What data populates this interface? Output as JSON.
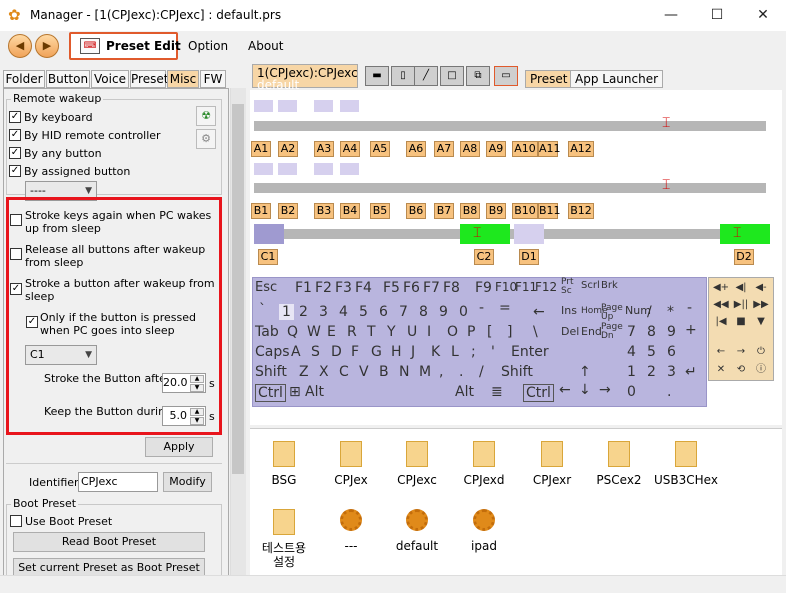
{
  "window": {
    "title": "Manager - [1(CPJexc):CPJexc] : default.prs",
    "controls": [
      "—",
      "☐",
      "✕"
    ]
  },
  "menubar": {
    "back": "◀",
    "forward": "▶",
    "preset_edit": "Preset Edit",
    "option": "Option",
    "about": "About"
  },
  "left_tabs": [
    "Folder",
    "Button",
    "Voice",
    "Preset",
    "Misc",
    "FW"
  ],
  "active_left_tab": "Misc",
  "remote_wakeup": {
    "title": "Remote wakeup",
    "by_keyboard": "By keyboard",
    "by_hid": "By HID remote controller",
    "by_any_button": "By any button",
    "by_assigned_button": "By assigned button",
    "assigned_value": "----",
    "checked": [
      true,
      true,
      true,
      true
    ]
  },
  "wake_options": {
    "stroke_keys_again": "Stroke keys again when PC wakes up from sleep",
    "release_all": "Release all buttons after wakeup from sleep",
    "stroke_button": "Stroke a button after wakeup from sleep",
    "only_if_pressed": "Only if the button is pressed when PC goes into sleep",
    "button_value": "C1",
    "stroke_after_label": "Stroke the Button after",
    "stroke_after_value": "20.0",
    "keep_during_label": "Keep the Button during",
    "keep_during_value": "5.0",
    "unit": "s",
    "apply": "Apply"
  },
  "identifier": {
    "label": "Identifier",
    "value": "CPJexc",
    "modify": "Modify"
  },
  "boot_preset": {
    "title": "Boot Preset",
    "use": "Use Boot Preset",
    "read": "Read Boot Preset",
    "set_current": "Set current Preset as Boot Preset"
  },
  "right_tabs": {
    "device_tab_line1": "1(CPJexc):CPJexc",
    "device_tab_line2": "default",
    "preset": "Preset",
    "app_launcher": "App Launcher"
  },
  "labels_row_a": [
    "A1",
    "A2",
    "A3",
    "A4",
    "A5",
    "A6",
    "A7",
    "A8",
    "A9",
    "A10",
    "A11",
    "A12"
  ],
  "labels_row_b": [
    "B1",
    "B2",
    "B3",
    "B4",
    "B5",
    "B6",
    "B7",
    "B8",
    "B9",
    "B10",
    "B11",
    "B12"
  ],
  "labels_row_cd": [
    "C1",
    "C2",
    "D1",
    "D2"
  ],
  "keyboard": {
    "row0": [
      "Esc",
      "F1",
      "F2",
      "F3",
      "F4",
      "F5",
      "F6",
      "F7",
      "F8",
      "F9",
      "F10",
      "F11",
      "F12",
      "Prt Sc",
      "Scrl",
      "Brk"
    ],
    "row1": [
      "`",
      "1",
      "2",
      "3",
      "4",
      "5",
      "6",
      "7",
      "8",
      "9",
      "0",
      "-",
      "=",
      "←",
      "Ins",
      "Home",
      "Page Up",
      "Num",
      "/",
      "*",
      "-"
    ],
    "row2": [
      "Tab",
      "Q",
      "W",
      "E",
      "R",
      "T",
      "Y",
      "U",
      "I",
      "O",
      "P",
      "[",
      "]",
      "\\",
      "Del",
      "End",
      "Page Dn",
      "7",
      "8",
      "9",
      "+"
    ],
    "row3": [
      "Caps",
      "A",
      "S",
      "D",
      "F",
      "G",
      "H",
      "J",
      "K",
      "L",
      ";",
      "'",
      "Enter",
      "4",
      "5",
      "6"
    ],
    "row4": [
      "Shift",
      "Z",
      "X",
      "C",
      "V",
      "B",
      "N",
      "M",
      ",",
      ".",
      "/",
      "Shift",
      "↑",
      "1",
      "2",
      "3",
      "↵"
    ],
    "row5": [
      "Ctrl",
      "⊞",
      "Alt",
      "Alt",
      "≣",
      "Ctrl",
      "←",
      "↓",
      "→",
      "0",
      "."
    ]
  },
  "media_keys": [
    "◀+",
    "◀|",
    "◀-",
    "◀◀",
    "▶||",
    "▶▶",
    "|◀",
    "■",
    "▼",
    "←",
    "→",
    "⏻",
    "✕",
    "⟲",
    "ⓘ"
  ],
  "files": [
    {
      "name": "BSG",
      "type": "file"
    },
    {
      "name": "CPJex",
      "type": "file"
    },
    {
      "name": "CPJexc",
      "type": "file"
    },
    {
      "name": "CPJexd",
      "type": "file"
    },
    {
      "name": "CPJexr",
      "type": "file"
    },
    {
      "name": "PSCex2",
      "type": "file"
    },
    {
      "name": "USB3CHex",
      "type": "file"
    },
    {
      "name": "테스트용\n설정",
      "type": "file"
    },
    {
      "name": "---",
      "type": "gear"
    },
    {
      "name": "default",
      "type": "gear"
    },
    {
      "name": "ipad",
      "type": "gear"
    }
  ],
  "colors": {
    "accent": "#f7c27f",
    "highlight": "#e8141c",
    "green": "#1ee81e",
    "marker": "#d40000"
  }
}
